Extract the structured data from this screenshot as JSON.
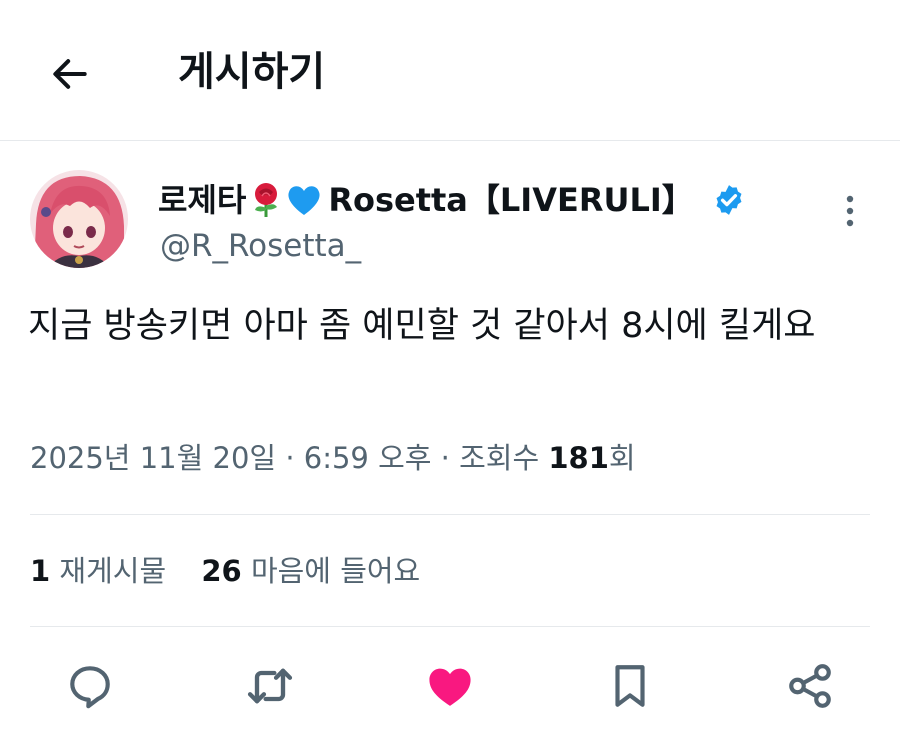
{
  "header": {
    "title": "게시하기"
  },
  "author": {
    "display_name_ko": "로제타",
    "display_name_en": "Rosetta【LIVERULI】",
    "handle": "@R_Rosetta_",
    "emoji_1": "rose-emoji",
    "emoji_2": "blue-heart-emoji",
    "verified": true
  },
  "tweet": {
    "text": "지금 방송키면 아마 좀 예민할 것 같아서 8시에 킬게요",
    "date": "2025년 11월 20일",
    "time": "6:59 오후",
    "views_label": "조회수",
    "views_count": "181",
    "views_suffix": "회"
  },
  "stats": {
    "retweets_count": "1",
    "retweets_label": "재게시물",
    "likes_count": "26",
    "likes_label": "마음에 들어요"
  },
  "actions": {
    "icons": [
      "reply-icon",
      "retweet-icon",
      "like-icon",
      "bookmark-icon",
      "share-icon"
    ],
    "liked": true
  },
  "colors": {
    "text": "#0f1419",
    "secondary": "#536471",
    "like": "#f91880",
    "verified": "#1d9bf0",
    "divider": "#e6e9ec"
  }
}
